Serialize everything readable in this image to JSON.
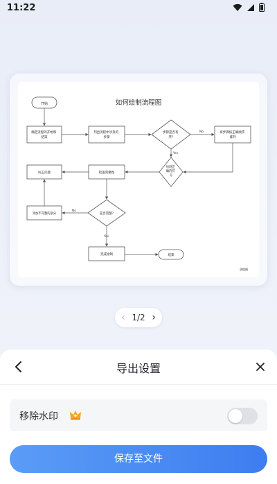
{
  "status_bar": {
    "time": "11:22",
    "icons": [
      "wifi-icon",
      "signal-icon",
      "battery-icon"
    ]
  },
  "preview": {
    "flowchart": {
      "title": "如何绘制流程图",
      "nodes": {
        "start": "开始",
        "define_scope": [
          "确定流程的开始和",
          "结束"
        ],
        "list_steps": [
          "列出流程中涉及的",
          "步骤"
        ],
        "order_question": [
          "步骤是否有",
          "序?"
        ],
        "sort_steps": [
          "将步骤按正确顺序",
          "排列"
        ],
        "draw_symbols": [
          "绘制正",
          "确的符",
          "号"
        ],
        "check_flow": "检查完整性",
        "fix_issue": "纠正问题",
        "complete_question": "是否完整?",
        "add_missing": "添加不完整的部分",
        "finish_draw": "完成绘制",
        "end": "结束",
        "no_1": "No",
        "yes_1": "Yes",
        "no_2": "No",
        "yes_2": "Yes",
        "watermark": "流程图"
      }
    }
  },
  "pager": {
    "prev": "‹",
    "current": "1/2",
    "next": "›"
  },
  "sheet": {
    "title": "导出设置",
    "option_label": "移除水印",
    "toggle_on": false,
    "save_label": "保存至文件"
  },
  "colors": {
    "accent": "#3d7df0",
    "accent_light": "#5a9cf6",
    "vip": "#f5a623"
  }
}
